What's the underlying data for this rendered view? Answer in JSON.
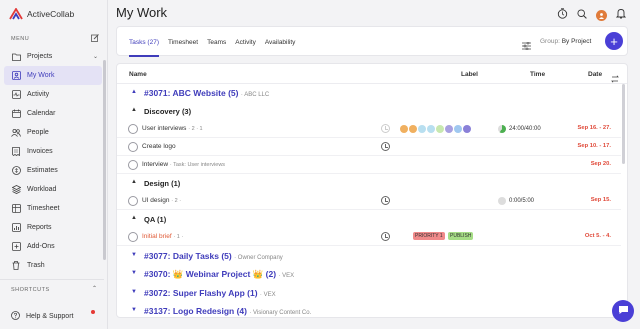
{
  "app": {
    "name": "ActiveCollab",
    "page_title": "My Work"
  },
  "sidebar": {
    "menu_label": "MENU",
    "items": [
      {
        "label": "Projects",
        "icon": "folder-icon",
        "active": false,
        "chevron": "⌄"
      },
      {
        "label": "My Work",
        "icon": "user-icon",
        "active": true
      },
      {
        "label": "Activity",
        "icon": "pulse-icon",
        "active": false
      },
      {
        "label": "Calendar",
        "icon": "calendar-icon",
        "active": false
      },
      {
        "label": "People",
        "icon": "people-icon",
        "active": false
      },
      {
        "label": "Invoices",
        "icon": "invoice-icon",
        "active": false
      },
      {
        "label": "Estimates",
        "icon": "estimate-icon",
        "active": false
      },
      {
        "label": "Workload",
        "icon": "stack-icon",
        "active": false
      },
      {
        "label": "Timesheet",
        "icon": "timesheet-icon",
        "active": false
      },
      {
        "label": "Reports",
        "icon": "reports-icon",
        "active": false
      },
      {
        "label": "Add-Ons",
        "icon": "addons-icon",
        "active": false
      },
      {
        "label": "Trash",
        "icon": "trash-icon",
        "active": false
      }
    ],
    "shortcuts_label": "SHORTCUTS",
    "help_label": "Help & Support"
  },
  "tabs": [
    {
      "label": "Tasks (27)",
      "active": true
    },
    {
      "label": "Timesheet",
      "active": false
    },
    {
      "label": "Teams",
      "active": false
    },
    {
      "label": "Activity",
      "active": false
    },
    {
      "label": "Availability",
      "active": false
    }
  ],
  "toolbar": {
    "group_by_prefix": "Group:",
    "group_by_value": "By Project",
    "add_label": "+"
  },
  "columns": {
    "name": "Name",
    "label": "Label",
    "time": "Time",
    "date": "Date"
  },
  "rows": {
    "p1": {
      "title": "#3071: ABC Website (5)",
      "client": "ABC LLC"
    },
    "g1": {
      "title": "Discovery (3)"
    },
    "t1": {
      "name": "User interviews",
      "meta": "· 2 · 1",
      "time": "24:00/40:00",
      "date": "Sep 16. - 27."
    },
    "t2": {
      "name": "Create logo",
      "date": "Sep 10. - 17."
    },
    "t3": {
      "name": "Interview",
      "meta": "· Task: User interviews",
      "date": "Sep 20."
    },
    "g2": {
      "title": "Design (1)"
    },
    "t4": {
      "name": "UI design",
      "meta": "· 2 ·",
      "time": "0:00/5:00",
      "date": "Sep 15."
    },
    "g3": {
      "title": "QA (1)"
    },
    "t5": {
      "name": "Initial brief",
      "meta": "· 1 ·",
      "label1": "PRIORITY 1",
      "label2": "PUBLISH",
      "date": "Oct 5. - 4."
    },
    "p2": {
      "title": "#3077: Daily Tasks (5)",
      "client": "Owner Company"
    },
    "p3": {
      "title": "#3070: 👑 Webinar Project 👑 (2)",
      "client": "VEX"
    },
    "p4": {
      "title": "#3072: Super Flashy App (1)",
      "client": "VEX"
    },
    "p5": {
      "title": "#3137: Logo Redesign (4)",
      "client": "Visionary Content Co."
    }
  },
  "colors": {
    "accent": "#3f3cbb",
    "add_button": "#4a3fd6",
    "overdue": "#e04a3a",
    "label_priority": "#f08a8a",
    "label_publish": "#a6dd86",
    "avatar_dots": [
      "#f0b060",
      "#f0b060",
      "#b8dff0",
      "#b8dff0",
      "#c8e8b0",
      "#a8a0e0",
      "#a0c8f0",
      "#8a80d8"
    ]
  }
}
